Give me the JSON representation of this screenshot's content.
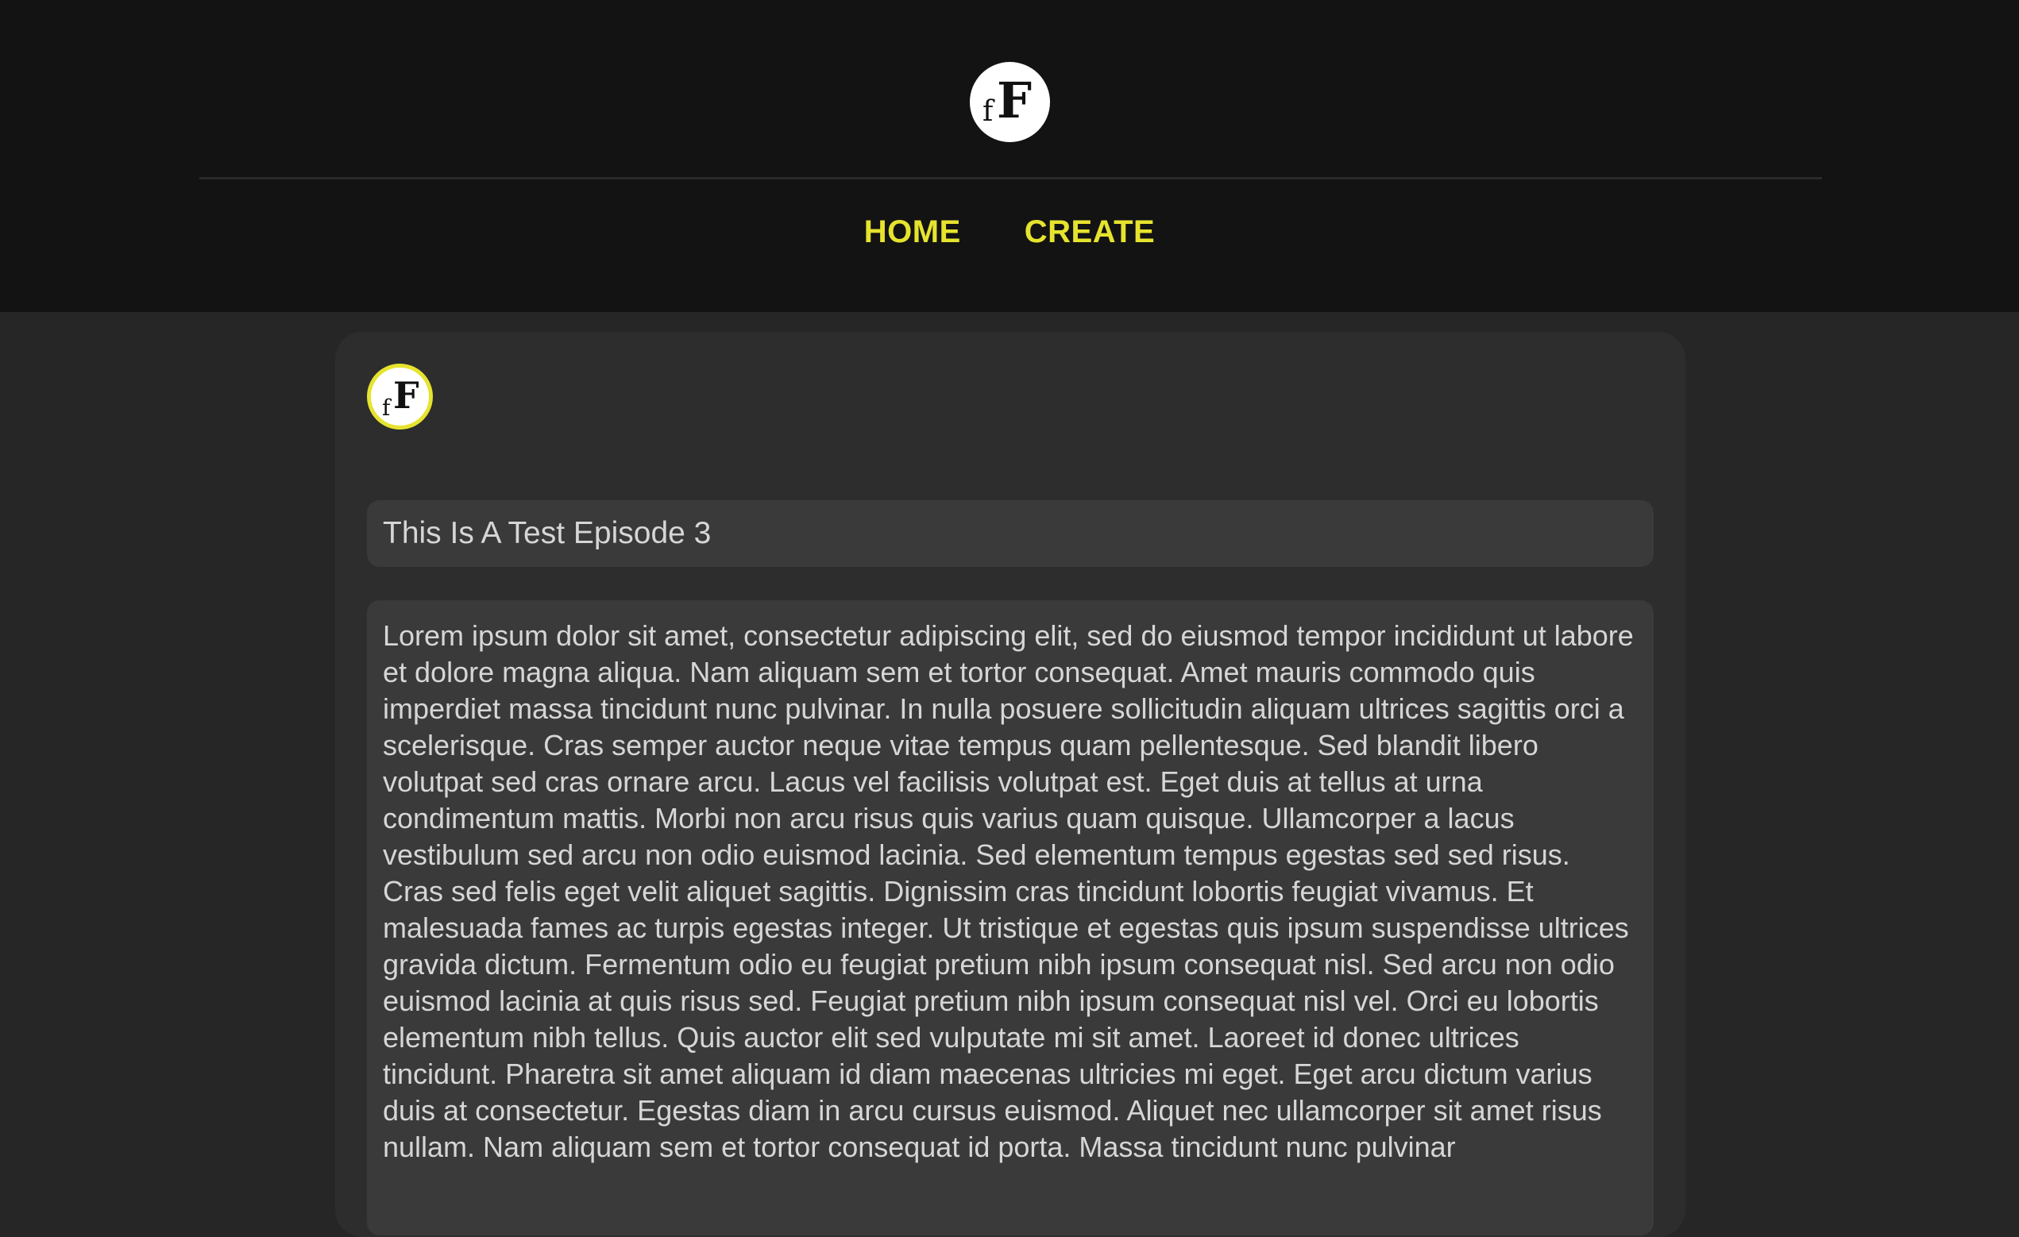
{
  "header": {
    "logo": {
      "small_letter": "f",
      "big_letter": "F",
      "icon": "ff-logo-icon"
    },
    "nav": {
      "home_label": "HOME",
      "create_label": "CREATE"
    }
  },
  "colors": {
    "accent": "#e6e32e",
    "header_bg": "#131313",
    "page_bg": "#262626",
    "card_bg": "#2d2d2d",
    "field_bg": "#3a3a3a",
    "text": "#d6d6d6"
  },
  "editor": {
    "avatar": {
      "small_letter": "f",
      "big_letter": "F"
    },
    "title_value": "This Is A Test Episode 3",
    "body_value": "Lorem ipsum dolor sit amet, consectetur adipiscing elit, sed do eiusmod tempor incididunt ut labore et dolore magna aliqua. Nam aliquam sem et tortor consequat. Amet mauris commodo quis imperdiet massa tincidunt nunc pulvinar. In nulla posuere sollicitudin aliquam ultrices sagittis orci a scelerisque. Cras semper auctor neque vitae tempus quam pellentesque. Sed blandit libero volutpat sed cras ornare arcu. Lacus vel facilisis volutpat est. Eget duis at tellus at urna condimentum mattis. Morbi non arcu risus quis varius quam quisque. Ullamcorper a lacus vestibulum sed arcu non odio euismod lacinia. Sed elementum tempus egestas sed sed risus. Cras sed felis eget velit aliquet sagittis. Dignissim cras tincidunt lobortis feugiat vivamus. Et malesuada fames ac turpis egestas integer. Ut tristique et egestas quis ipsum suspendisse ultrices gravida dictum. Fermentum odio eu feugiat pretium nibh ipsum consequat nisl. Sed arcu non odio euismod lacinia at quis risus sed. Feugiat pretium nibh ipsum consequat nisl vel. Orci eu lobortis elementum nibh tellus. Quis auctor elit sed vulputate mi sit amet. Laoreet id donec ultrices tincidunt. Pharetra sit amet aliquam id diam maecenas ultricies mi eget. Eget arcu dictum varius duis at consectetur. Egestas diam in arcu cursus euismod. Aliquet nec ullamcorper sit amet risus nullam. Nam aliquam sem et tortor consequat id porta. Massa tincidunt nunc pulvinar"
  }
}
